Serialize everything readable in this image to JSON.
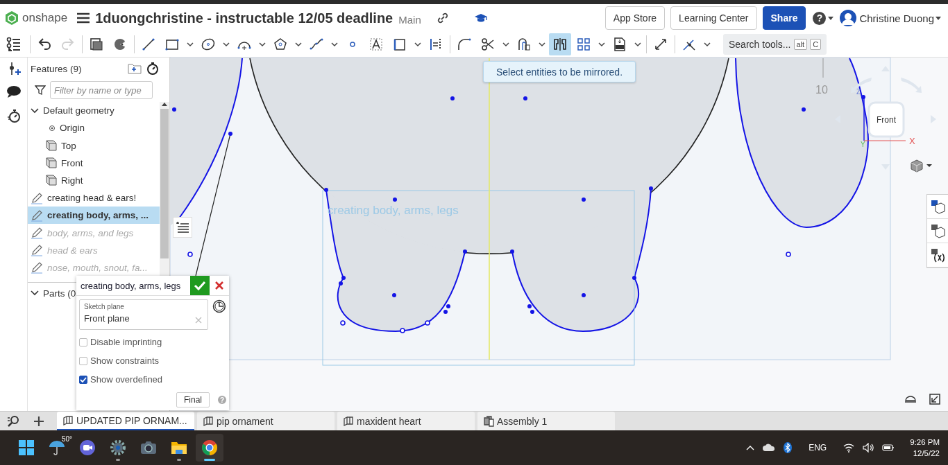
{
  "header": {
    "brand": "onshape",
    "title": "1duongchristine - instructable 12/05 deadline",
    "branch": "Main",
    "buttons": [
      {
        "label": "App Store",
        "kind": "plain"
      },
      {
        "label": "Learning Center",
        "kind": "plain"
      },
      {
        "label": "Share",
        "kind": "primary"
      }
    ],
    "help": "?",
    "user": "Christine Duong"
  },
  "toolbar": {
    "groups": [
      [
        {
          "kind": "undo",
          "dropdown": false,
          "selected": false,
          "disabled": false
        },
        {
          "kind": "redo",
          "dropdown": false,
          "selected": false,
          "disabled": true
        }
      ],
      [
        {
          "kind": "sketch-copy",
          "dropdown": false,
          "selected": false,
          "disabled": false
        },
        {
          "kind": "use",
          "dropdown": false,
          "selected": false,
          "disabled": false
        }
      ],
      [
        {
          "kind": "line",
          "dropdown": false,
          "selected": false,
          "disabled": false
        },
        {
          "kind": "rectangle",
          "dropdown": true,
          "selected": false,
          "disabled": false
        },
        {
          "kind": "ellipse",
          "dropdown": true,
          "selected": false,
          "disabled": false
        },
        {
          "kind": "arc",
          "dropdown": true,
          "selected": false,
          "disabled": false
        },
        {
          "kind": "polygon",
          "dropdown": true,
          "selected": false,
          "disabled": false
        },
        {
          "kind": "spline",
          "dropdown": true,
          "selected": false,
          "disabled": false
        },
        {
          "kind": "point",
          "dropdown": false,
          "selected": false,
          "disabled": false
        },
        {
          "kind": "text",
          "dropdown": false,
          "selected": false,
          "disabled": false
        },
        {
          "kind": "frame",
          "dropdown": true,
          "selected": false,
          "disabled": false
        },
        {
          "kind": "align",
          "dropdown": false,
          "selected": false,
          "disabled": false
        }
      ],
      [
        {
          "kind": "fillet",
          "dropdown": false,
          "selected": false,
          "disabled": false
        },
        {
          "kind": "trim",
          "dropdown": true,
          "selected": false,
          "disabled": false
        },
        {
          "kind": "offset",
          "dropdown": true,
          "selected": false,
          "disabled": false
        },
        {
          "kind": "mirror",
          "dropdown": false,
          "selected": true,
          "disabled": false
        },
        {
          "kind": "pattern",
          "dropdown": true,
          "selected": false,
          "disabled": false
        },
        {
          "kind": "dxf",
          "dropdown": true,
          "selected": false,
          "disabled": false
        }
      ],
      [
        {
          "kind": "transform",
          "dropdown": false,
          "selected": false,
          "disabled": false
        }
      ],
      [
        {
          "kind": "intersect",
          "dropdown": true,
          "selected": false,
          "disabled": false
        }
      ]
    ],
    "search": {
      "label": "Search tools...",
      "keys": [
        "alt",
        "C"
      ]
    }
  },
  "features": {
    "title": "Features (9)",
    "filter_placeholder": "Filter by name or type",
    "items": [
      {
        "kind": "group",
        "label": "Default geometry",
        "expanded": true,
        "selected": false,
        "rolled_back": false,
        "children": [
          {
            "kind": "origin",
            "label": "Origin",
            "selected": false,
            "rolled_back": false
          },
          {
            "kind": "plane",
            "label": "Top",
            "selected": false,
            "rolled_back": false
          },
          {
            "kind": "plane",
            "label": "Front",
            "selected": false,
            "rolled_back": false
          },
          {
            "kind": "plane",
            "label": "Right",
            "selected": false,
            "rolled_back": false
          }
        ]
      },
      {
        "kind": "sketch",
        "label": "creating head & ears!",
        "selected": false,
        "rolled_back": false
      },
      {
        "kind": "sketch",
        "label": "creating body, arms, ...",
        "selected": true,
        "rolled_back": false
      },
      {
        "kind": "sketch",
        "label": "body, arms, and legs",
        "selected": false,
        "rolled_back": true
      },
      {
        "kind": "sketch",
        "label": "head & ears",
        "selected": false,
        "rolled_back": true
      },
      {
        "kind": "sketch",
        "label": "nose, mouth, snout, fa...",
        "selected": false,
        "rolled_back": true
      }
    ],
    "parts": {
      "label": "Parts (0",
      "expanded": true
    }
  },
  "canvas": {
    "sketch_label": "creating body, arms, legs",
    "dimension": "10",
    "view_cube": {
      "face": "Front",
      "x_axis": "X",
      "y_axis": "Y",
      "z_axis": "Z"
    },
    "tooltip": "Select entities to be mirrored."
  },
  "sketch_dialog": {
    "title": "creating body, arms, legs",
    "plane_label": "Sketch plane",
    "plane_value": "Front plane",
    "options": [
      {
        "label": "Disable imprinting",
        "checked": false
      },
      {
        "label": "Show constraints",
        "checked": false
      },
      {
        "label": "Show overdefined",
        "checked": true
      }
    ],
    "final_button": "Final",
    "help": "?"
  },
  "tabs": [
    {
      "label": "UPDATED PIP ORNAM...",
      "kind": "part-studio",
      "selected": true
    },
    {
      "label": "pip ornament",
      "kind": "part-studio",
      "selected": false
    },
    {
      "label": "maxident heart",
      "kind": "part-studio",
      "selected": false
    },
    {
      "label": "Assembly 1",
      "kind": "assembly",
      "selected": false
    }
  ],
  "taskbar": {
    "apps": [
      {
        "kind": "start",
        "running": false,
        "active": false
      },
      {
        "kind": "weather",
        "label": "50°",
        "running": false,
        "active": false
      },
      {
        "kind": "chat",
        "running": false,
        "active": false
      },
      {
        "kind": "settings",
        "running": true,
        "active": false
      },
      {
        "kind": "camera",
        "running": false,
        "active": false
      },
      {
        "kind": "files",
        "running": true,
        "active": false
      },
      {
        "kind": "browser",
        "running": true,
        "active": true
      }
    ],
    "tray": {
      "language": "ENG",
      "time": "9:26 PM",
      "date": "12/5/22"
    }
  }
}
